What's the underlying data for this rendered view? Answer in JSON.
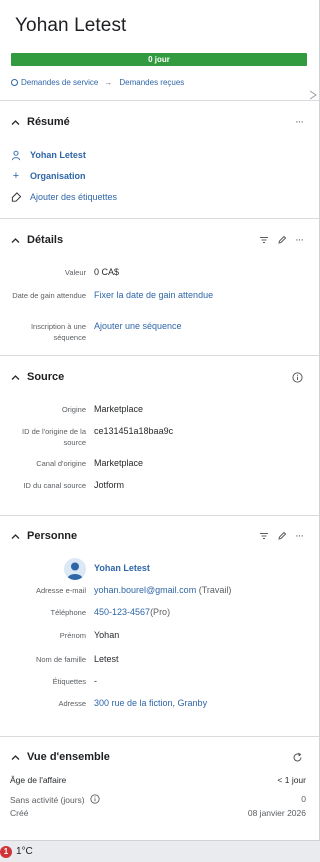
{
  "deal": {
    "title": "Yohan  Letest"
  },
  "progress": {
    "label": "0 jour"
  },
  "breadcrumb": {
    "first": "Demandes de service",
    "second": "Demandes reçues"
  },
  "summary": {
    "title": "Résumé",
    "contact": "Yohan Letest",
    "organization": "Organisation",
    "add_labels": "Ajouter des étiquettes"
  },
  "details": {
    "title": "Détails",
    "fields": [
      {
        "label": "Valeur",
        "value": "0 CA$"
      },
      {
        "label": "Date de gain attendue",
        "value": "Fixer la date de gain attendue"
      },
      {
        "label": "Inscription à une séquence",
        "value": "Ajouter une séquence"
      }
    ]
  },
  "source": {
    "title": "Source",
    "fields": [
      {
        "label": "Origine",
        "value": "Marketplace"
      },
      {
        "label": "ID de l'origine de la source",
        "value": "ce131451a18baa9c"
      },
      {
        "label": "Canal d'origine",
        "value": "Marketplace"
      },
      {
        "label": "ID du canal source",
        "value": "Jotform"
      }
    ]
  },
  "person": {
    "title": "Personne",
    "name": "Yohan Letest",
    "fields": [
      {
        "label": "Adresse e-mail",
        "value": "yohan.bourel@gmail.com",
        "suffix": "(Travail)"
      },
      {
        "label": "Téléphone",
        "value": "450-123-4567",
        "suffix": "(Pro)"
      },
      {
        "label": "Prénom",
        "value": "Yohan"
      },
      {
        "label": "Nom de famille",
        "value": "Letest"
      },
      {
        "label": "Étiquettes",
        "value": "-"
      },
      {
        "label": "Adresse",
        "value": "300 rue de la fiction, Granby"
      }
    ]
  },
  "overview": {
    "title": "Vue d'ensemble",
    "rows": [
      {
        "label": "Âge de l'affaire",
        "value": "< 1 jour"
      },
      {
        "label": "Sans activité (jours)",
        "value": "0"
      },
      {
        "label": "Créé",
        "value": "08 janvier 2026"
      }
    ]
  },
  "taskbar": {
    "badge": "1",
    "temperature": "1°C"
  },
  "colors": {
    "accent": "#2f66a8",
    "progress": "#339b3f",
    "alert": "#d13438"
  }
}
